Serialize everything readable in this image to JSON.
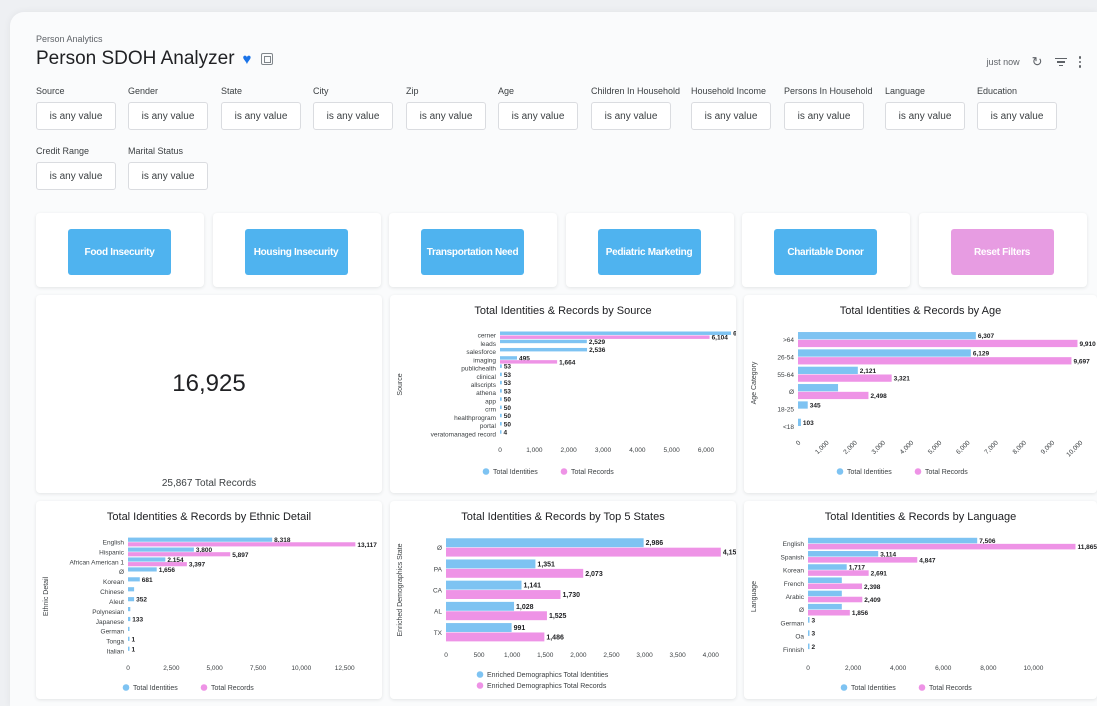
{
  "header": {
    "breadcrumb": "Person Analytics",
    "title": "Person SDOH Analyzer",
    "updated": "just now"
  },
  "filters": [
    {
      "label": "Source",
      "value": "is any value"
    },
    {
      "label": "Gender",
      "value": "is any value"
    },
    {
      "label": "State",
      "value": "is any value"
    },
    {
      "label": "City",
      "value": "is any value"
    },
    {
      "label": "Zip",
      "value": "is any value"
    },
    {
      "label": "Age",
      "value": "is any value"
    },
    {
      "label": "Children In Household",
      "value": "is any value"
    },
    {
      "label": "Household Income",
      "value": "is any value"
    },
    {
      "label": "Persons In Household",
      "value": "is any value"
    },
    {
      "label": "Language",
      "value": "is any value"
    },
    {
      "label": "Education",
      "value": "is any value"
    },
    {
      "label": "Credit Range",
      "value": "is any value"
    },
    {
      "label": "Marital Status",
      "value": "is any value"
    }
  ],
  "actions": [
    {
      "label": "Food Insecurity",
      "color": "#4fb3ef"
    },
    {
      "label": "Housing Insecurity",
      "color": "#4fb3ef"
    },
    {
      "label": "Transportation Need",
      "color": "#4fb3ef"
    },
    {
      "label": "Pediatric Marketing",
      "color": "#4fb3ef"
    },
    {
      "label": "Charitable Donor",
      "color": "#4fb3ef"
    },
    {
      "label": "Reset Filters",
      "color": "#e79ce2"
    }
  ],
  "kpi": {
    "value": "16,925",
    "records_text": "25,867 Total Records"
  },
  "colors": {
    "identities": "#7ec3f2",
    "records": "#ee93e6"
  },
  "chart_data": [
    {
      "id": "source",
      "type": "bar",
      "orientation": "horizontal",
      "title": "Total Identities & Records by Source",
      "ylabel": "Source",
      "xlabel": "",
      "categories": [
        "cerner",
        "leads",
        "salesforce",
        "imaging",
        "publichealth",
        "clinical",
        "allscripts",
        "athena",
        "app",
        "crm",
        "healthprogram",
        "portal",
        "veratomanaged record"
      ],
      "series": [
        {
          "name": "Total Identities",
          "values": [
            6730,
            2529,
            2536,
            495,
            53,
            53,
            53,
            53,
            50,
            50,
            50,
            50,
            4
          ],
          "labels": [
            "6,730",
            "2,529",
            "2,536",
            "495",
            "53",
            "53",
            "53",
            "53",
            "50",
            "50",
            "50",
            "50",
            "4"
          ]
        },
        {
          "name": "Total Records",
          "values": [
            6104,
            null,
            null,
            1664,
            null,
            null,
            null,
            null,
            null,
            null,
            null,
            null,
            null
          ],
          "labels": [
            "6,104",
            "",
            "",
            "1,664",
            "",
            "",
            "",
            "",
            "",
            "",
            "",
            "",
            ""
          ]
        }
      ],
      "xlim": [
        0,
        6000
      ],
      "xticks": [
        "0",
        "1,000",
        "2,000",
        "3,000",
        "4,000",
        "5,000",
        "6,000"
      ],
      "legend": [
        "Total Identities",
        "Total Records"
      ]
    },
    {
      "id": "age",
      "type": "bar",
      "orientation": "horizontal",
      "title": "Total Identities & Records by Age",
      "ylabel": "Age Category",
      "xlabel": "",
      "categories": [
        ">64",
        "26-54",
        "55-64",
        "Ø",
        "18-25",
        "<18"
      ],
      "series": [
        {
          "name": "Total Identities",
          "values": [
            6307,
            6129,
            2121,
            1420,
            345,
            103
          ],
          "labels": [
            "6,307",
            "6,129",
            "2,121",
            "",
            "345",
            "103"
          ]
        },
        {
          "name": "Total Records",
          "values": [
            9910,
            9697,
            3321,
            2498,
            null,
            null
          ],
          "labels": [
            "9,910",
            "9,697",
            "3,321",
            "2,498",
            "",
            ""
          ]
        }
      ],
      "xlim": [
        0,
        10000
      ],
      "xticks": [
        "0",
        "1,000",
        "2,000",
        "3,000",
        "4,000",
        "5,000",
        "6,000",
        "7,000",
        "8,000",
        "9,000",
        "10,000"
      ],
      "legend": [
        "Total Identities",
        "Total Records"
      ]
    },
    {
      "id": "ethnic",
      "type": "bar",
      "orientation": "horizontal",
      "title": "Total Identities & Records by Ethnic Detail",
      "ylabel": "Ethnic Detail",
      "xlabel": "",
      "categories": [
        "English",
        "Hispanic",
        "African American 1",
        "Ø",
        "Korean",
        "Chinese",
        "Aleut",
        "Polynesian",
        "Japanese",
        "German",
        "Tonga",
        "Italian"
      ],
      "series": [
        {
          "name": "Total Identities",
          "values": [
            8318,
            3800,
            2154,
            1656,
            681,
            352,
            352,
            133,
            133,
            1,
            1,
            1
          ],
          "labels": [
            "8,318",
            "3,800",
            "2,154",
            "1,656",
            "681",
            "",
            "352",
            "",
            "133",
            "",
            "1",
            "1"
          ]
        },
        {
          "name": "Total Records",
          "values": [
            13117,
            5897,
            3397,
            null,
            null,
            null,
            null,
            null,
            null,
            null,
            null,
            null
          ],
          "labels": [
            "13,117",
            "5,897",
            "3,397",
            "",
            "",
            "",
            "",
            "",
            "",
            "",
            "",
            ""
          ]
        }
      ],
      "xlim": [
        0,
        13500
      ],
      "xticks": [
        "0",
        "2,500",
        "5,000",
        "7,500",
        "10,000",
        "12,500"
      ],
      "legend": [
        "Total Identities",
        "Total Records"
      ]
    },
    {
      "id": "states",
      "type": "bar",
      "orientation": "horizontal",
      "title": "Total Identities & Records by Top 5 States",
      "ylabel": "Enriched Demographics State",
      "xlabel": "",
      "categories": [
        "Ø",
        "PA",
        "CA",
        "AL",
        "TX"
      ],
      "series": [
        {
          "name": "Enriched Demographics Total Identities",
          "values": [
            2986,
            1351,
            1141,
            1028,
            991
          ],
          "labels": [
            "2,986",
            "1,351",
            "1,141",
            "1,028",
            "991"
          ]
        },
        {
          "name": "Enriched Demographics Total Records",
          "values": [
            4152,
            2073,
            1730,
            1525,
            1486
          ],
          "labels": [
            "4,152",
            "2,073",
            "1,730",
            "1,525",
            "1,486"
          ]
        }
      ],
      "xlim": [
        0,
        4200
      ],
      "xticks": [
        "0",
        "500",
        "1,000",
        "1,500",
        "2,000",
        "2,500",
        "3,000",
        "3,500",
        "4,000"
      ],
      "legend": [
        "Enriched Demographics Total Identities",
        "Enriched Demographics Total Records"
      ]
    },
    {
      "id": "language",
      "type": "bar",
      "orientation": "horizontal",
      "title": "Total Identities & Records by Language",
      "ylabel": "Language",
      "xlabel": "",
      "categories": [
        "English",
        "Spanish",
        "Korean",
        "French",
        "Arabic",
        "Ø",
        "German",
        "Oa",
        "Finnish"
      ],
      "series": [
        {
          "name": "Total Identities",
          "values": [
            7506,
            3114,
            1717,
            1500,
            1500,
            1500,
            3,
            3,
            2
          ],
          "labels": [
            "7,506",
            "3,114",
            "1,717",
            "",
            "",
            "",
            "3",
            "3",
            "2"
          ]
        },
        {
          "name": "Total Records",
          "values": [
            11865,
            4847,
            2691,
            2398,
            2409,
            1856,
            null,
            null,
            null
          ],
          "labels": [
            "11,865",
            "4,847",
            "2,691",
            "2,398",
            "2,409",
            "1,856",
            "",
            "",
            ""
          ]
        }
      ],
      "xlim": [
        0,
        11800
      ],
      "xticks": [
        "0",
        "2,000",
        "4,000",
        "6,000",
        "8,000",
        "10,000"
      ],
      "legend": [
        "Total Identities",
        "Total Records"
      ]
    }
  ]
}
